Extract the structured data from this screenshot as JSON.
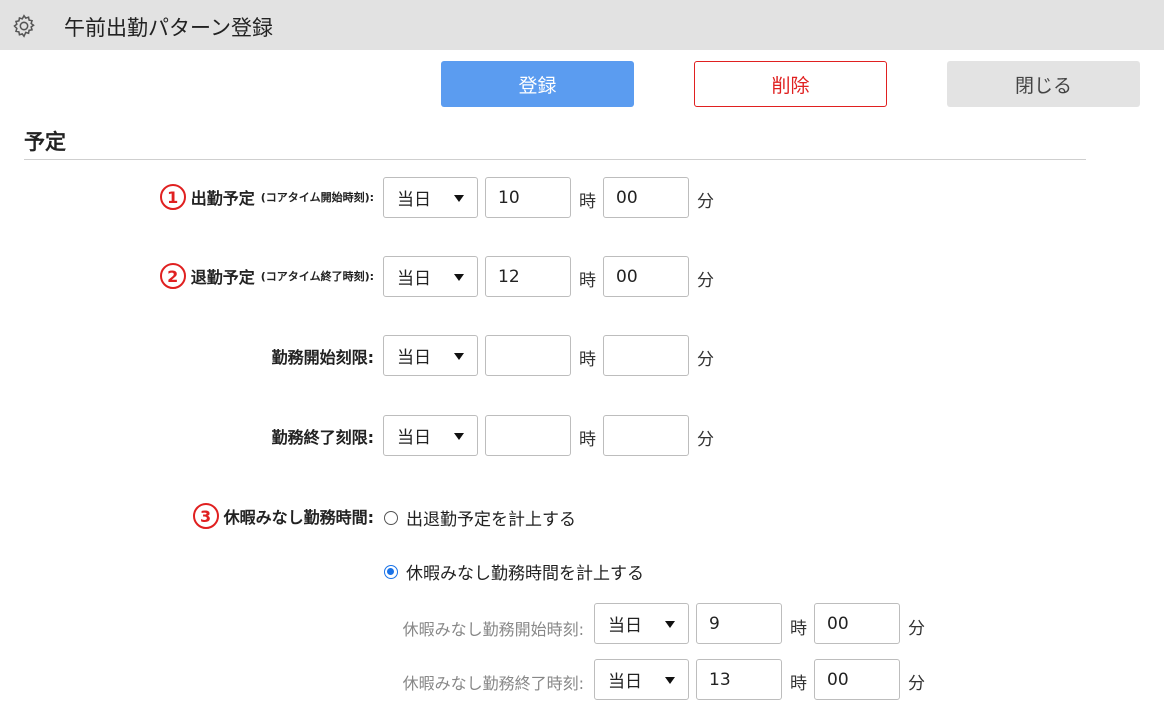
{
  "window": {
    "title": "午前出勤パターン登録",
    "icon": "gear-icon"
  },
  "toolbar": {
    "register_label": "登録",
    "delete_label": "削除",
    "close_label": "閉じる"
  },
  "colors": {
    "primary": "#5b9cf0",
    "danger": "#e02020",
    "titlebar": "#e2e2e2",
    "radio_selected": "#1a73e8"
  },
  "section": {
    "title": "予定"
  },
  "units": {
    "hour": "時",
    "minute": "分"
  },
  "rows": [
    {
      "badge": "1",
      "label": "出勤予定",
      "note": "(コアタイム開始時刻):",
      "day": "当日",
      "hour": "10",
      "minute": "00"
    },
    {
      "badge": "2",
      "label": "退勤予定",
      "note": "(コアタイム終了時刻):",
      "day": "当日",
      "hour": "12",
      "minute": "00"
    },
    {
      "label": "勤務開始刻限:",
      "day": "当日",
      "hour": "",
      "minute": ""
    },
    {
      "label": "勤務終了刻限:",
      "day": "当日",
      "hour": "",
      "minute": ""
    }
  ],
  "leave": {
    "badge": "3",
    "label": "休暇みなし勤務時間:",
    "options": [
      {
        "label": "出退勤予定を計上する",
        "selected": false
      },
      {
        "label": "休暇みなし勤務時間を計上する",
        "selected": true
      }
    ],
    "start": {
      "label": "休暇みなし勤務開始時刻:",
      "day": "当日",
      "hour": "9",
      "minute": "00"
    },
    "end": {
      "label": "休暇みなし勤務終了時刻:",
      "day": "当日",
      "hour": "13",
      "minute": "00"
    }
  }
}
